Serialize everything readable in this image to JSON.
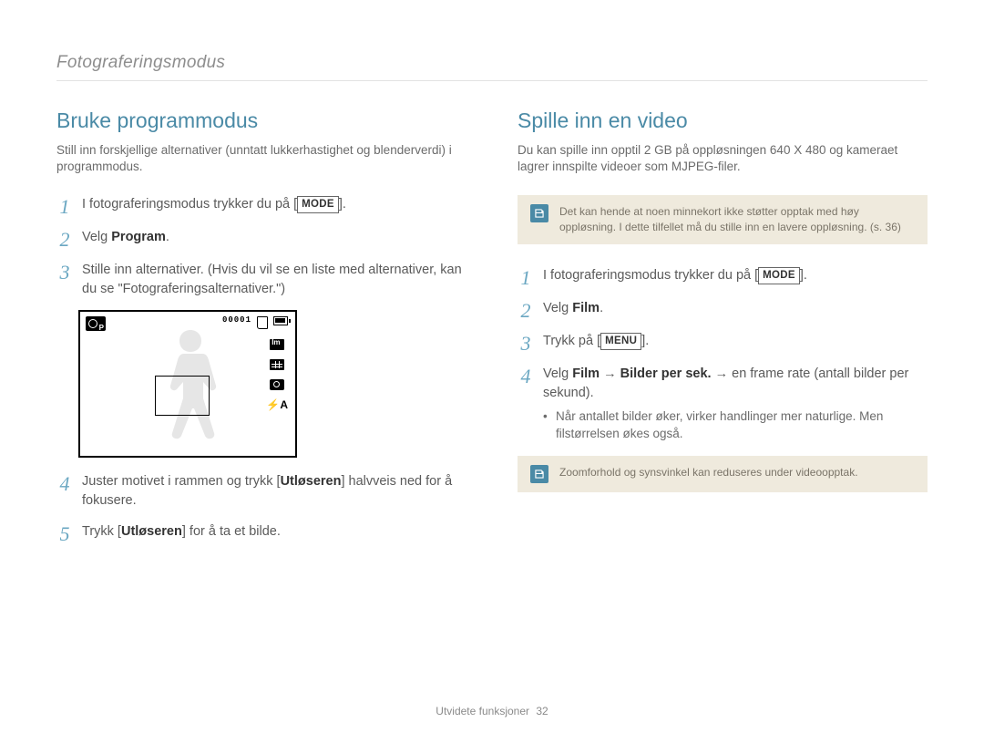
{
  "header": "Fotograferingsmodus",
  "footer": {
    "label": "Utvidete funksjoner",
    "page": "32"
  },
  "left": {
    "title": "Bruke programmodus",
    "intro": "Still inn forskjellige alternativer (unntatt lukkerhastighet og blenderverdi) i programmodus.",
    "steps": {
      "s1": {
        "pre": "I fotograferingsmodus trykker du på [",
        "badge": "MODE",
        "post": "]."
      },
      "s2": {
        "pre": "Velg ",
        "bold": "Program",
        "post": "."
      },
      "s3": "Stille inn alternativer. (Hvis du vil se en liste med alternativer, kan du se \"Fotograferingsalternativer.\")",
      "s4": {
        "a": "Juster motivet i rammen og trykk [",
        "b": "Utløseren",
        "c": "] halvveis ned for å fokusere."
      },
      "s5": {
        "a": "Trykk [",
        "b": "Utløseren",
        "c": "] for å ta et bilde."
      }
    },
    "preview": {
      "counter": "00001",
      "flash": "⚡A"
    }
  },
  "right": {
    "title": "Spille inn en video",
    "intro": "Du kan spille inn opptil 2 GB på oppløsningen 640 X 480 og kameraet lagrer innspilte videoer som MJPEG-filer.",
    "note1": "Det kan hende at noen minnekort ikke støtter opptak med høy oppløsning. I dette tilfellet må du stille inn en lavere oppløsning. (s. 36)",
    "steps": {
      "s1": {
        "pre": "I fotograferingsmodus trykker du på [",
        "badge": "MODE",
        "post": "]."
      },
      "s2": {
        "pre": "Velg ",
        "bold": "Film",
        "post": "."
      },
      "s3": {
        "pre": "Trykk på [",
        "badge": "MENU",
        "post": "]."
      },
      "s4": {
        "a": "Velg ",
        "b1": "Film",
        "arrow1": " → ",
        "b2": "Bilder per sek.",
        "arrow2": " → ",
        "c": "en frame rate (antall bilder per sekund)."
      },
      "bullet": "Når antallet bilder øker, virker handlinger mer naturlige. Men filstørrelsen økes også."
    },
    "note2": "Zoomforhold og synsvinkel kan reduseres under videoopptak."
  }
}
